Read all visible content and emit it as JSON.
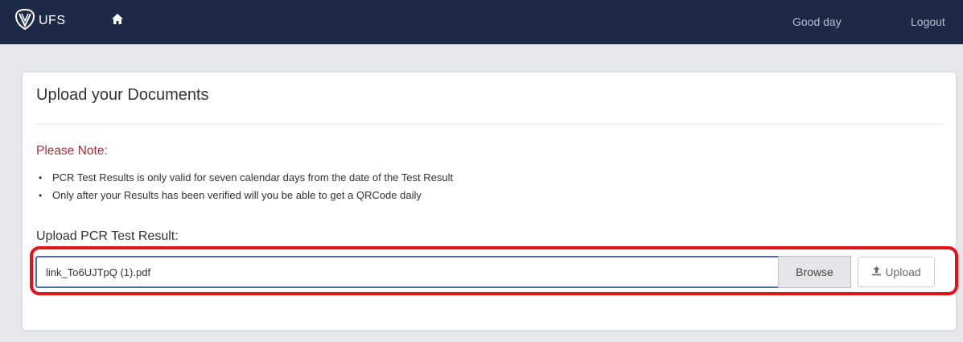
{
  "navbar": {
    "brand": "UFS",
    "greeting": "Good day",
    "logout": "Logout"
  },
  "panel": {
    "title": "Upload your Documents",
    "note_heading": "Please Note:",
    "notes": [
      "PCR Test Results is only valid for seven calendar days from the date of the Test Result",
      "Only after your Results has been verified will you be able to get a QRCode daily"
    ],
    "upload_label": "Upload PCR Test Result:",
    "file_value": "link_To6UJTpQ (1).pdf",
    "browse_label": "Browse",
    "upload_label_btn": "Upload"
  },
  "colors": {
    "navbar_bg": "#1c2a48",
    "note_heading": "#a8313b",
    "highlight": "#e3111a"
  },
  "icons": {
    "logo": "ufs-shield-logo",
    "home": "home-icon",
    "upload": "upload-icon"
  }
}
